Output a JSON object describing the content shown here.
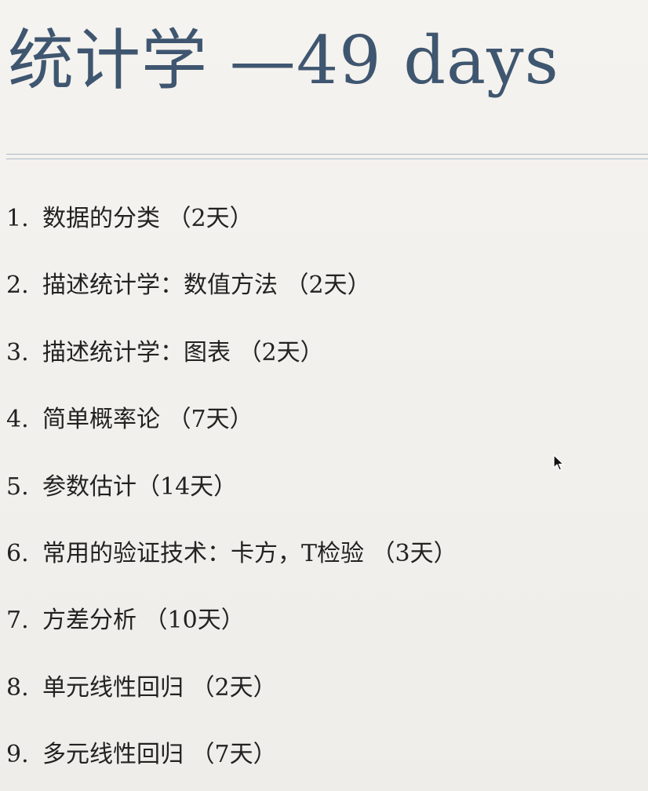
{
  "slide": {
    "title": "统计学 —49 days",
    "items": [
      {
        "number": "1.",
        "text": "数据的分类 （2天）"
      },
      {
        "number": "2.",
        "text": "描述统计学：数值方法 （2天）"
      },
      {
        "number": "3.",
        "text": "描述统计学：图表 （2天）"
      },
      {
        "number": "4.",
        "text": "简单概率论 （7天）"
      },
      {
        "number": "5.",
        "text": "参数估计（14天）"
      },
      {
        "number": "6.",
        "text": "常用的验证技术：卡方，T检验 （3天）"
      },
      {
        "number": "7.",
        "text": "方差分析 （10天）"
      },
      {
        "number": "8.",
        "text": "单元线性回归 （2天）"
      },
      {
        "number": "9.",
        "text": "多元线性回归 （7天）"
      }
    ]
  },
  "colors": {
    "background": "#f3f1ed",
    "title": "#3f5670",
    "rule": "#a9b8c9",
    "body_text": "#222222"
  },
  "icons": {
    "pointer": "mouse-pointer-icon"
  }
}
